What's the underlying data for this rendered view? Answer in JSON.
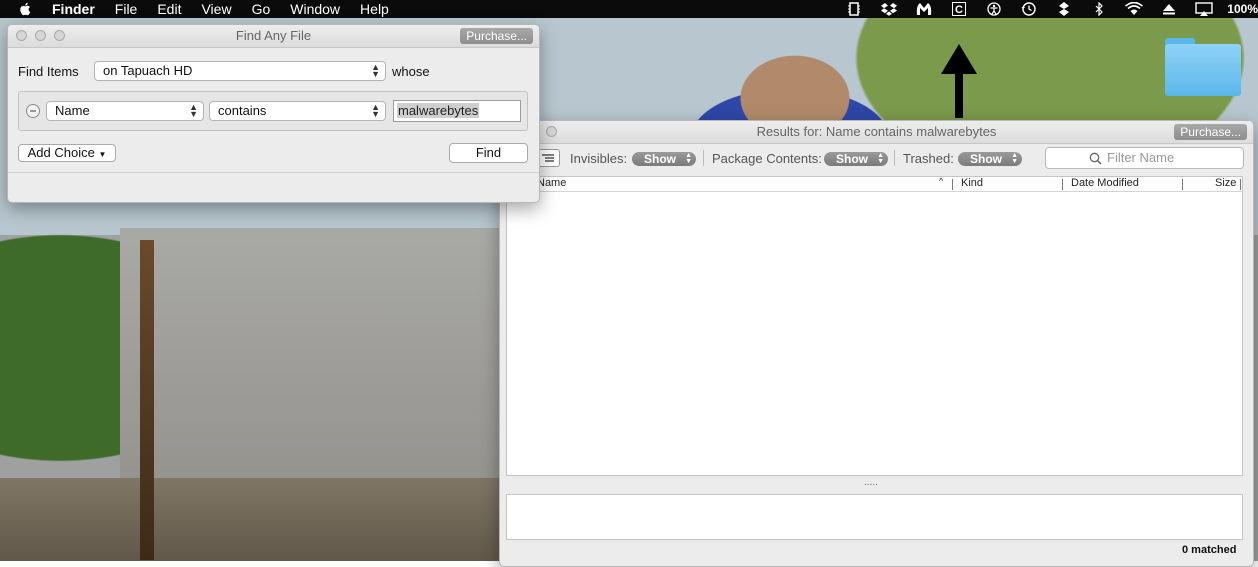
{
  "menubar": {
    "items": [
      "Finder",
      "File",
      "Edit",
      "View",
      "Go",
      "Window",
      "Help"
    ],
    "battery": "100%"
  },
  "find_window": {
    "title": "Find Any File",
    "purchase": "Purchase...",
    "find_items_label": "Find Items",
    "location_value": "on Tapuach HD",
    "whose_label": "whose",
    "criteria_field": "Name",
    "criteria_operator": "contains",
    "criteria_value": "malwarebytes",
    "add_choice": "Add Choice",
    "find_button": "Find"
  },
  "results_window": {
    "title": "Results for: Name contains malwarebytes",
    "purchase": "Purchase...",
    "invisibles_label": "Invisibles:",
    "invisibles_value": "Show",
    "package_label": "Package Contents:",
    "package_value": "Show",
    "trashed_label": "Trashed:",
    "trashed_value": "Show",
    "filter_placeholder": "Filter Name",
    "columns": [
      "Name",
      "Kind",
      "Date Modified",
      "Size"
    ],
    "splitter": ".....",
    "status": "0 matched"
  },
  "colors": {
    "menubar_bg": "#0b0b0b",
    "window_bg": "#ececec",
    "pill_bg": "#8a8a8a",
    "purchase_bg": "#9a9a9a"
  }
}
